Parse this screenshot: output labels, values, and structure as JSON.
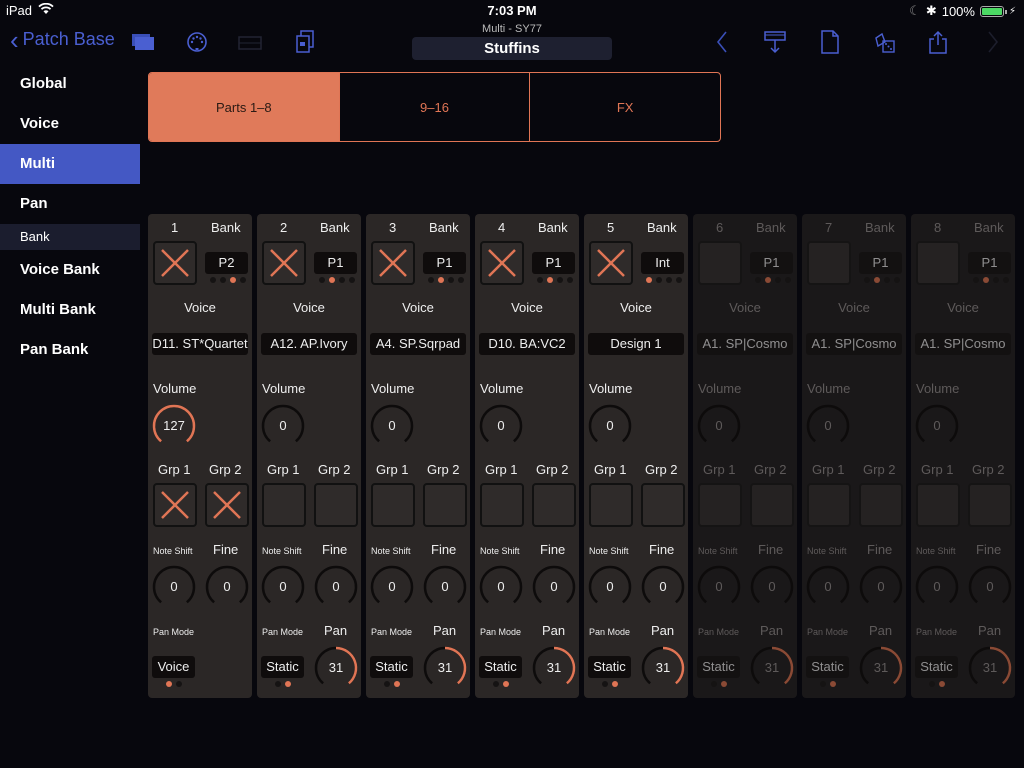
{
  "status": {
    "device": "iPad",
    "time": "7:03 PM",
    "battery": "100%",
    "battery_level": 1.0
  },
  "nav": {
    "back_label": "Patch Base",
    "subtitle": "Multi - SY77",
    "title": "Stuffins",
    "left_icons": [
      "folder-icon",
      "midi-port-icon",
      "keyboard-icon",
      "copy-documents-icon"
    ],
    "right_icons": [
      "chevron-left-icon",
      "send-to-synth-icon",
      "new-document-icon",
      "randomize-dice-icon",
      "share-icon",
      "chevron-right-icon"
    ]
  },
  "sidebar": {
    "items": [
      {
        "label": "Global",
        "active": false
      },
      {
        "label": "Voice",
        "active": false
      },
      {
        "label": "Multi",
        "active": true
      },
      {
        "label": "Pan",
        "active": false
      }
    ],
    "section": "Bank",
    "bank_items": [
      {
        "label": "Voice Bank"
      },
      {
        "label": "Multi Bank"
      },
      {
        "label": "Pan Bank"
      }
    ]
  },
  "segments": [
    {
      "label": "Parts 1–8",
      "active": true
    },
    {
      "label": "9–16",
      "active": false
    },
    {
      "label": "FX",
      "active": false
    }
  ],
  "labels": {
    "bank": "Bank",
    "voice": "Voice",
    "volume": "Volume",
    "grp1": "Grp 1",
    "grp2": "Grp 2",
    "note_shift": "Note Shift",
    "fine": "Fine",
    "pan_mode": "Pan Mode",
    "pan": "Pan"
  },
  "colors": {
    "accent": "#e07555",
    "nav_blue": "#4a5fd1"
  },
  "parts": [
    {
      "num": "1",
      "enabled": true,
      "bank": "P2",
      "bank_index": 2,
      "voice": "D11. ST*Quartet",
      "volume": "127",
      "volume_frac": 1.0,
      "grp1": true,
      "grp2": true,
      "note_shift": "0",
      "fine": "0",
      "pan_mode": "Voice",
      "pan_mode_index": 0,
      "pan": null,
      "pan_frac": null
    },
    {
      "num": "2",
      "enabled": true,
      "bank": "P1",
      "bank_index": 1,
      "voice": "A12. AP.Ivory",
      "volume": "0",
      "volume_frac": 0,
      "grp1": false,
      "grp2": false,
      "note_shift": "0",
      "fine": "0",
      "pan_mode": "Static",
      "pan_mode_index": 1,
      "pan": "31",
      "pan_frac": 0.5
    },
    {
      "num": "3",
      "enabled": true,
      "bank": "P1",
      "bank_index": 1,
      "voice": "A4. SP.Sqrpad",
      "volume": "0",
      "volume_frac": 0,
      "grp1": false,
      "grp2": false,
      "note_shift": "0",
      "fine": "0",
      "pan_mode": "Static",
      "pan_mode_index": 1,
      "pan": "31",
      "pan_frac": 0.5
    },
    {
      "num": "4",
      "enabled": true,
      "bank": "P1",
      "bank_index": 1,
      "voice": "D10. BA:VC2",
      "volume": "0",
      "volume_frac": 0,
      "grp1": false,
      "grp2": false,
      "note_shift": "0",
      "fine": "0",
      "pan_mode": "Static",
      "pan_mode_index": 1,
      "pan": "31",
      "pan_frac": 0.5
    },
    {
      "num": "5",
      "enabled": true,
      "bank": "Int",
      "bank_index": 0,
      "voice": "Design 1",
      "volume": "0",
      "volume_frac": 0,
      "grp1": false,
      "grp2": false,
      "note_shift": "0",
      "fine": "0",
      "pan_mode": "Static",
      "pan_mode_index": 1,
      "pan": "31",
      "pan_frac": 0.5
    },
    {
      "num": "6",
      "enabled": false,
      "bank": "P1",
      "bank_index": 1,
      "voice": "A1. SP|Cosmo",
      "volume": "0",
      "volume_frac": 0,
      "grp1": false,
      "grp2": false,
      "note_shift": "0",
      "fine": "0",
      "pan_mode": "Static",
      "pan_mode_index": 1,
      "pan": "31",
      "pan_frac": 0.5
    },
    {
      "num": "7",
      "enabled": false,
      "bank": "P1",
      "bank_index": 1,
      "voice": "A1. SP|Cosmo",
      "volume": "0",
      "volume_frac": 0,
      "grp1": false,
      "grp2": false,
      "note_shift": "0",
      "fine": "0",
      "pan_mode": "Static",
      "pan_mode_index": 1,
      "pan": "31",
      "pan_frac": 0.5
    },
    {
      "num": "8",
      "enabled": false,
      "bank": "P1",
      "bank_index": 1,
      "voice": "A1. SP|Cosmo",
      "volume": "0",
      "volume_frac": 0,
      "grp1": false,
      "grp2": false,
      "note_shift": "0",
      "fine": "0",
      "pan_mode": "Static",
      "pan_mode_index": 1,
      "pan": "31",
      "pan_frac": 0.5
    }
  ]
}
